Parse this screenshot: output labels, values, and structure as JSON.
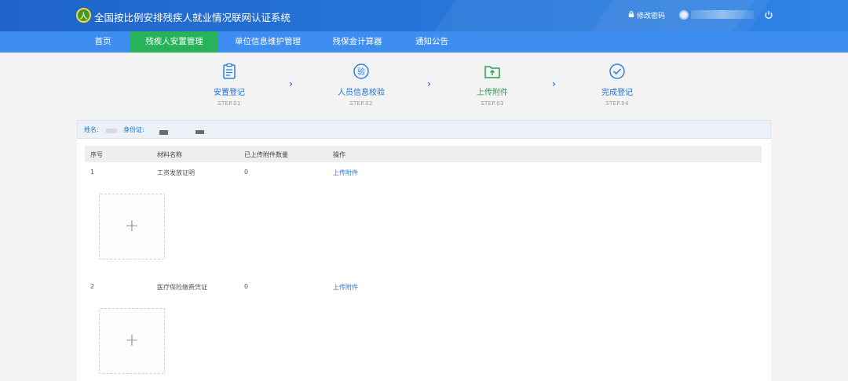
{
  "header": {
    "logo_glyph": "人",
    "site_title": "全国按比例安排残疾人就业情况联网认证系统",
    "change_password": "修改密码",
    "user_name": "",
    "accent": "#2673d8"
  },
  "nav": {
    "items": [
      {
        "label": "首页"
      },
      {
        "label": "残疾人安置管理",
        "active": true
      },
      {
        "label": "单位信息维护管理"
      },
      {
        "label": "残保金计算器"
      },
      {
        "label": "通知公告"
      }
    ],
    "active_color": "#27b35a"
  },
  "steps": [
    {
      "icon": "clipboard-icon",
      "title": "安置登记",
      "sub": "STEP.01"
    },
    {
      "icon": "verify-icon",
      "title": "人员信息校验",
      "sub": "STEP.02"
    },
    {
      "icon": "upload-folder-icon",
      "title": "上传附件",
      "sub": "STEP.03"
    },
    {
      "icon": "check-circle-icon",
      "title": "完成登记",
      "sub": "STEP.04"
    }
  ],
  "step_arrow": "›",
  "person": {
    "name_label": "姓名:",
    "id_label": "身份证:"
  },
  "table": {
    "headers": [
      "序号",
      "材料名称",
      "已上传附件数量",
      "操作"
    ],
    "rows": [
      {
        "index": "1",
        "name": "工资发放证明",
        "count": "0",
        "action": "上传附件"
      },
      {
        "index": "2",
        "name": "医疗保险缴费凭证",
        "count": "0",
        "action": "上传附件"
      }
    ],
    "upload_plus": "+"
  }
}
